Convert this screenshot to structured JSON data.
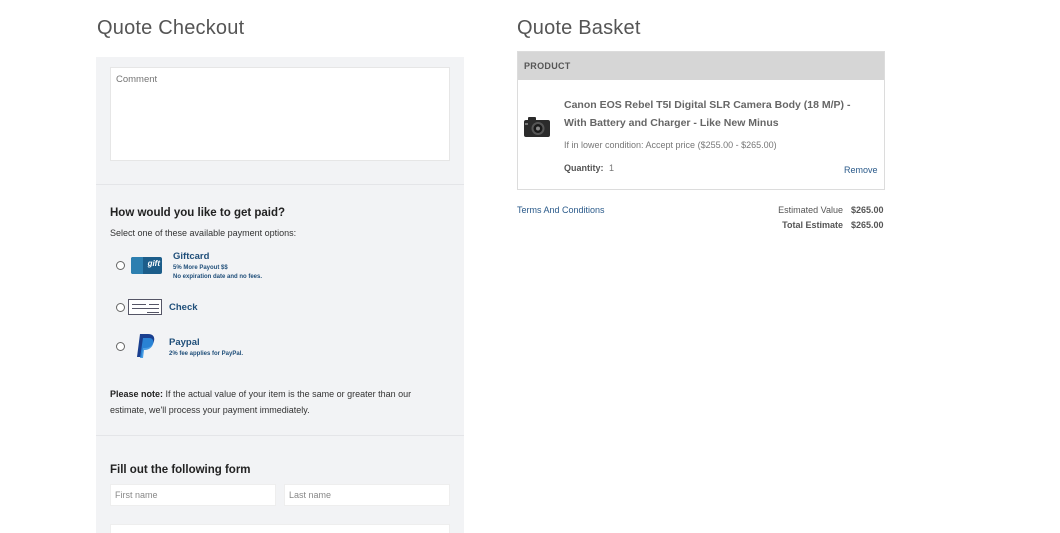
{
  "checkout": {
    "title": "Quote Checkout",
    "comment_placeholder": "Comment",
    "payment": {
      "title": "How would you like to get paid?",
      "subtitle": "Select one of these available payment options:",
      "options": [
        {
          "label": "Giftcard",
          "notes": [
            "5% More Payout $$",
            "No expiration date and no fees."
          ],
          "icon": "giftcard-icon"
        },
        {
          "label": "Check",
          "notes": [],
          "icon": "check-icon"
        },
        {
          "label": "Paypal",
          "notes": [
            "2% fee applies for PayPal."
          ],
          "icon": "paypal-icon"
        }
      ],
      "note_bold": "Please note:",
      "note_text": " If the actual value of your item is the same or greater than our estimate, we'll process your payment immediately."
    },
    "form": {
      "title": "Fill out the following form",
      "first_name_placeholder": "First name",
      "last_name_placeholder": "Last name"
    }
  },
  "basket": {
    "title": "Quote Basket",
    "column_header": "PRODUCT",
    "item": {
      "name": "Canon EOS Rebel T5I Digital SLR Camera Body (18 M/P) - With Battery and Charger - Like New Minus",
      "condition": "If in lower condition: Accept price ($255.00 - $265.00)",
      "quantity_label": "Quantity:",
      "quantity_value": "1",
      "remove_label": "Remove",
      "icon": "camera-icon"
    },
    "terms_label": "Terms And Conditions",
    "estimated_value_label": "Estimated Value",
    "estimated_value": "$265.00",
    "total_estimate_label": "Total Estimate",
    "total_estimate": "$265.00"
  },
  "colors": {
    "accent_blue": "#1f4e79",
    "link_blue": "#2a5a8a",
    "panel_bg": "#f2f3f5",
    "table_head_bg": "#d6d6d6"
  }
}
